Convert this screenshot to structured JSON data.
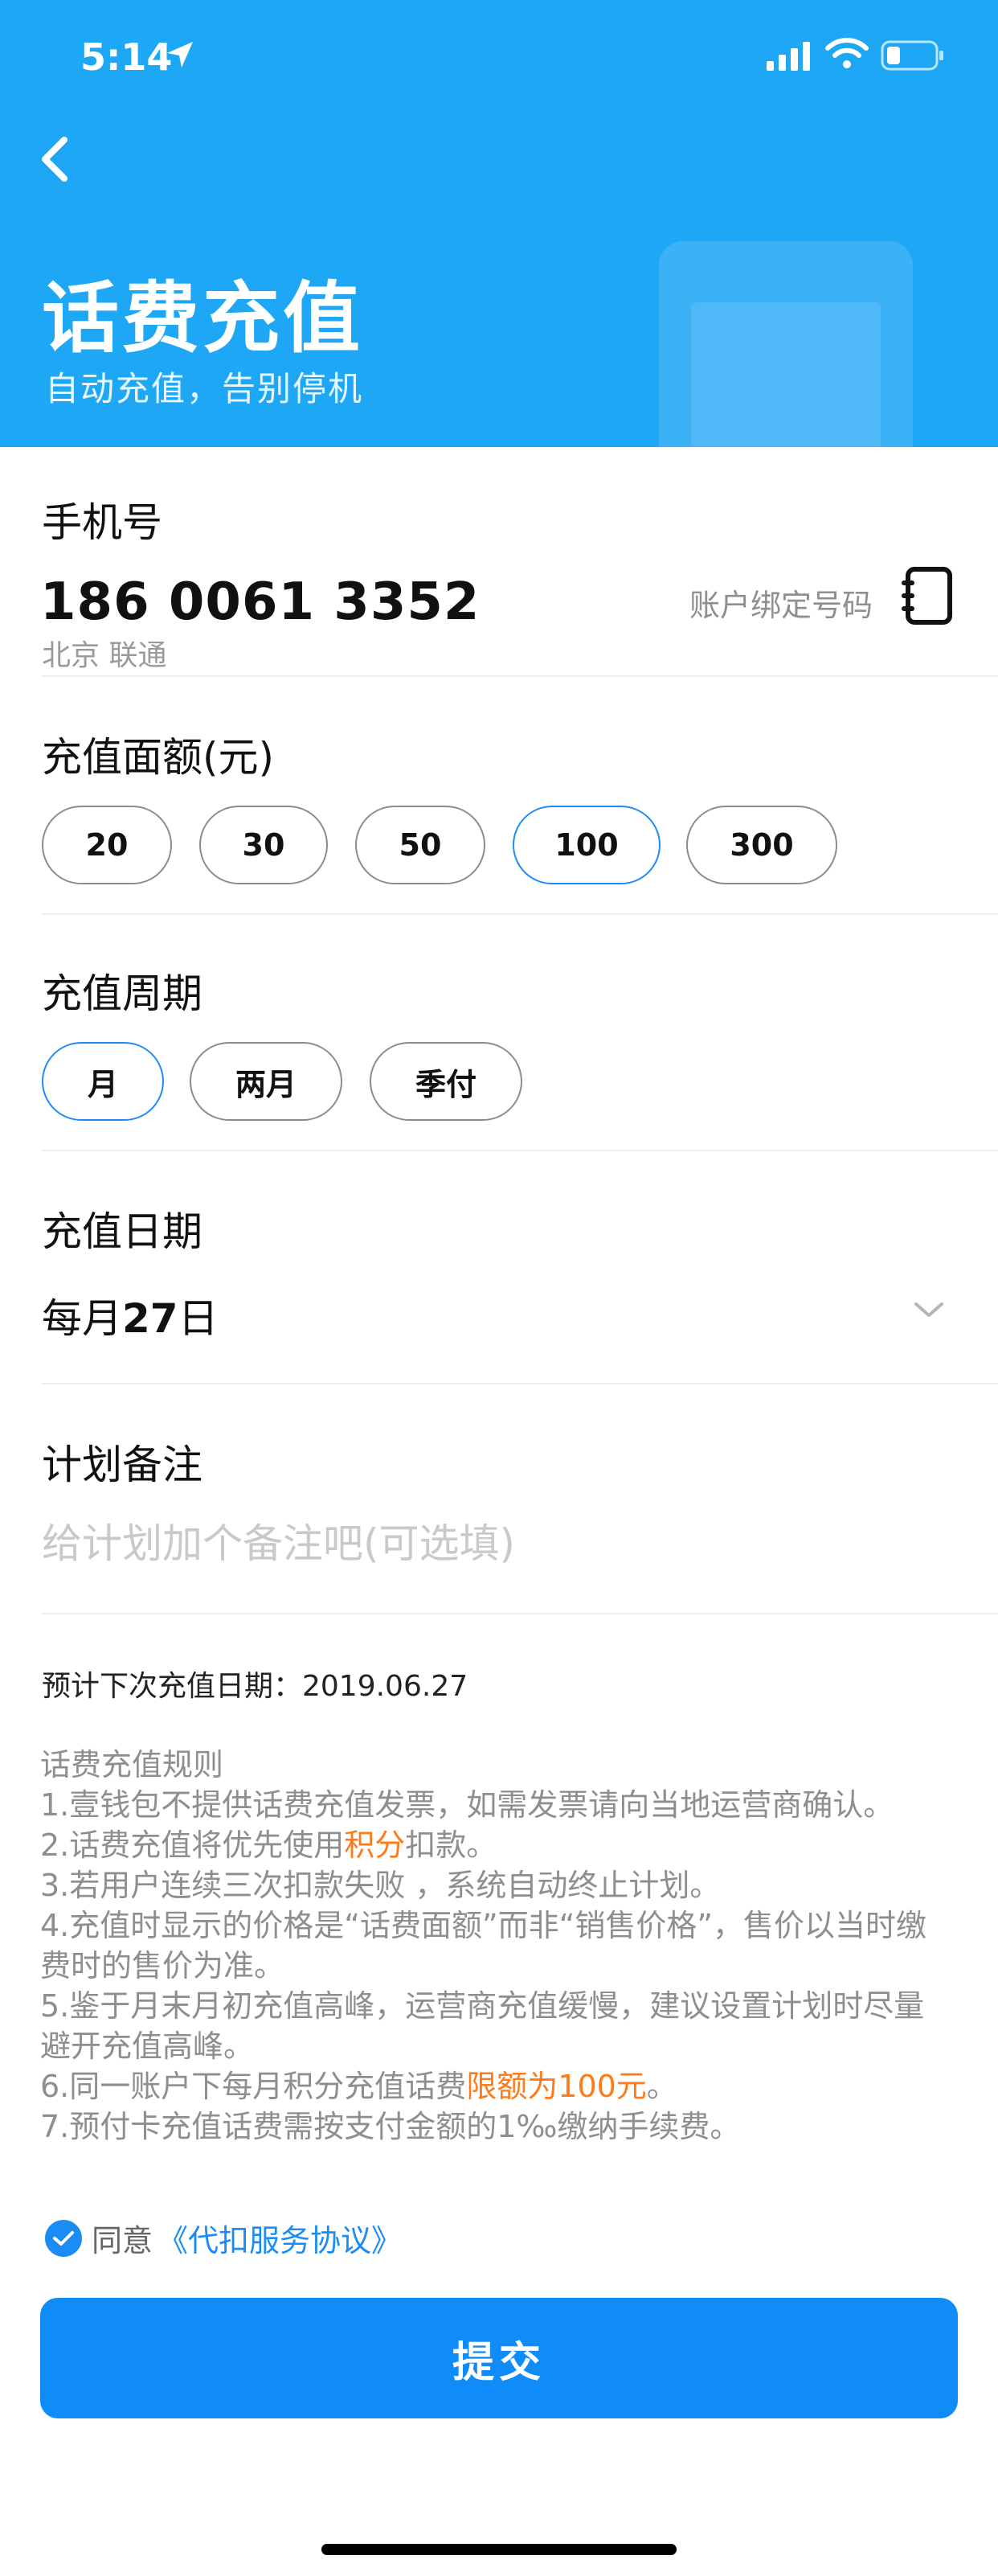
{
  "status_bar": {
    "time": "5:14"
  },
  "header": {
    "title": "话费充值",
    "subtitle": "自动充值，告别停机"
  },
  "phone_section": {
    "label": "手机号",
    "number": "186 0061 3352",
    "region": "北京 联通",
    "bind_label": "账户绑定号码"
  },
  "amount_section": {
    "label": "充值面额(元)",
    "options": [
      "20",
      "30",
      "50",
      "100",
      "300"
    ],
    "selected": "100"
  },
  "period_section": {
    "label": "充值周期",
    "options": [
      "月",
      "两月",
      "季付"
    ],
    "selected": "月"
  },
  "date_section": {
    "label": "充值日期",
    "prefix": "每月",
    "day": "27",
    "suffix": "日"
  },
  "note_section": {
    "label": "计划备注",
    "placeholder": "给计划加个备注吧(可选填)"
  },
  "next_date": "预计下次充值日期：2019.06.27",
  "rules": {
    "title": "话费充值规则",
    "r1": "1.壹钱包不提供话费充值发票，如需发票请向当地运营商确认。",
    "r2_a": "2.话费充值将优先使用",
    "r2_hl": "积分",
    "r2_b": "扣款。",
    "r3": "3.若用户连续三次扣款失败 ，系统自动终止计划。",
    "r4_l1": "4.充值时显示的价格是“话费面额”而非“销售价格”，售价以当时缴",
    "r4_l2": "费时的售价为准。",
    "r5_l1": "5.鉴于月末月初充值高峰，运营商充值缓慢，建议设置计划时尽量",
    "r5_l2": "避开充值高峰。",
    "r6_a": "6.同一账户下每月积分充值话费",
    "r6_hl": "限额为100元",
    "r6_b": "。",
    "r7": "7.预付卡充值话费需按支付金额的1‰缴纳手续费。"
  },
  "agreement": {
    "prefix": "同意",
    "link": "《代扣服务协议》"
  },
  "submit_label": "提交",
  "colors": {
    "header_bg": "#1ea7f5",
    "accent": "#1c8cf5",
    "highlight": "#ff7a1a",
    "button": "#0f8cf8"
  }
}
